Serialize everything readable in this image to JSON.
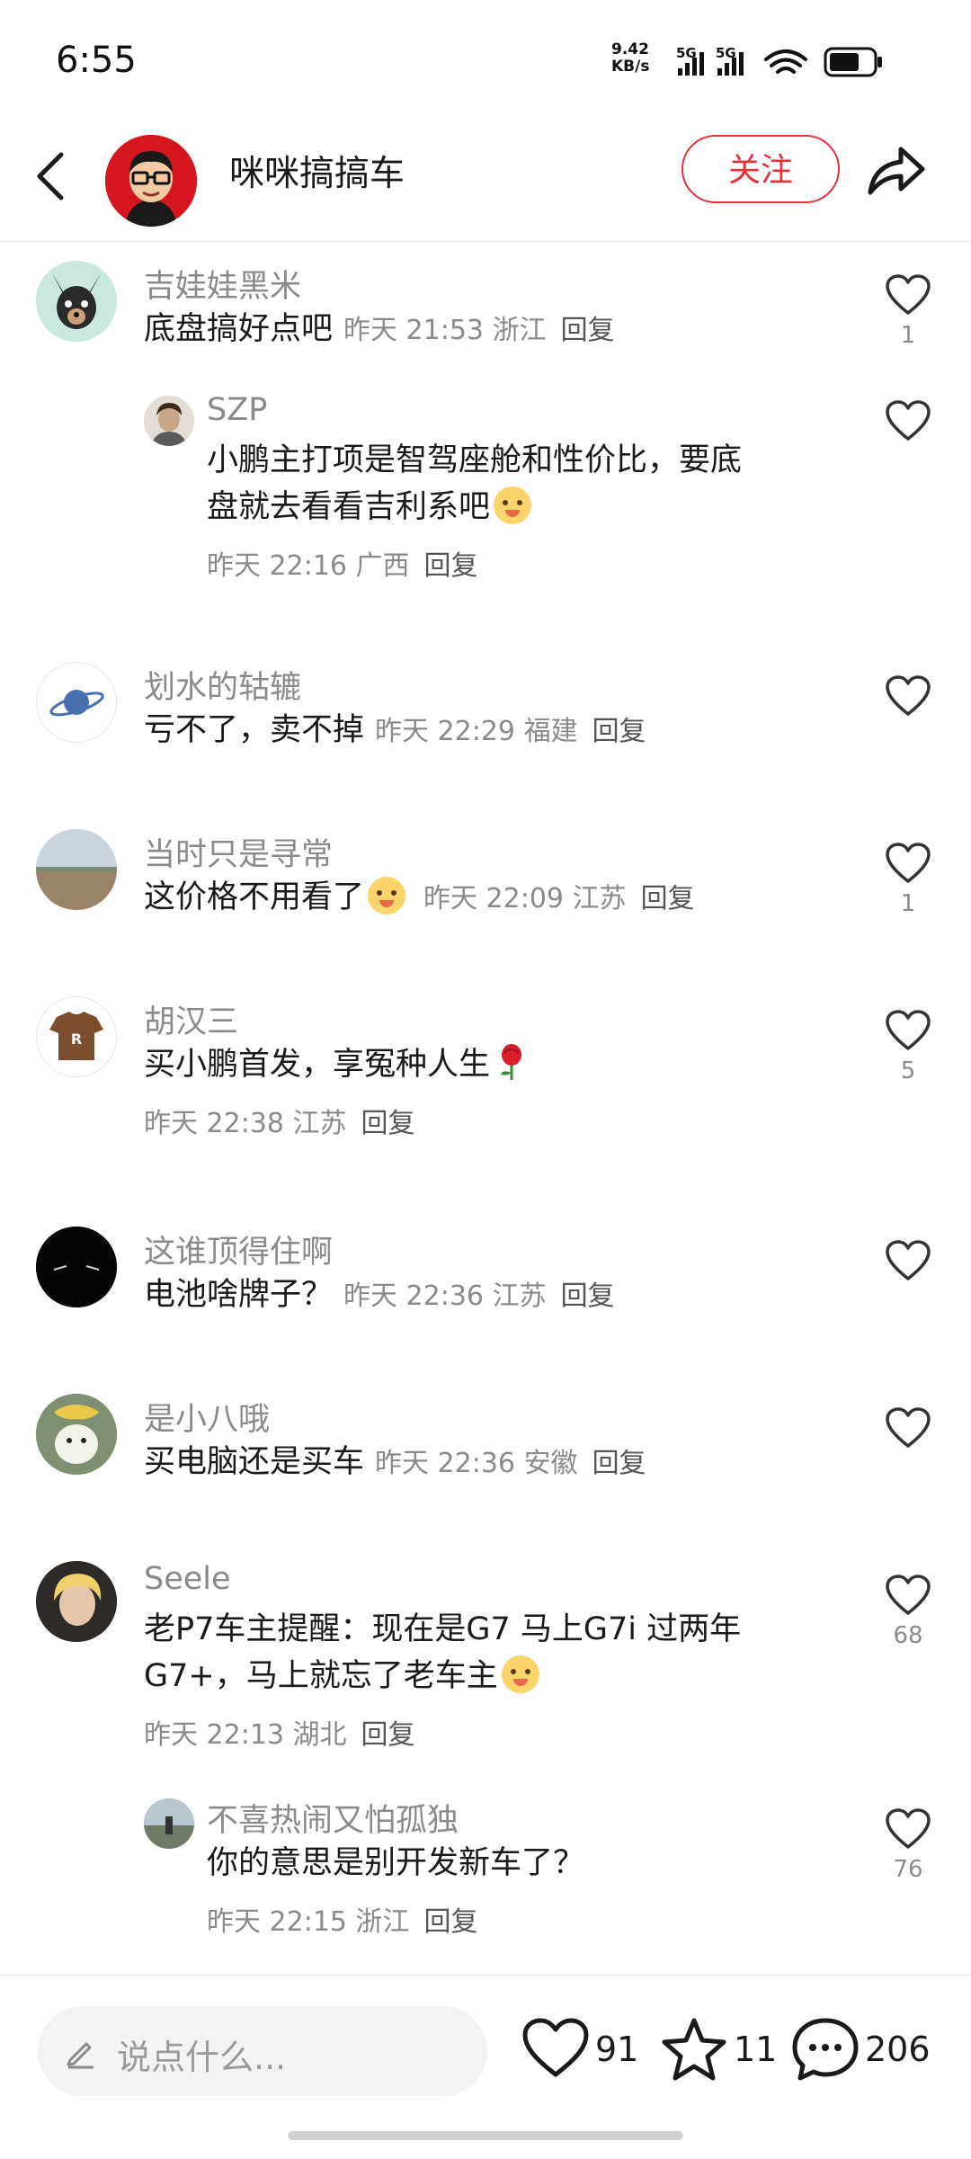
{
  "status_bar": {
    "time": "6:55",
    "net_speed_value": "9.42",
    "net_speed_unit": "KB/s",
    "sim1": "5G",
    "sim2": "5G",
    "battery_level": 0.7
  },
  "header": {
    "author_name": "咪咪搞搞车",
    "follow_label": "关注"
  },
  "comments": [
    {
      "name": "吉娃娃黑米",
      "text": "底盘搞好点吧",
      "time": "昨天 21:53",
      "location": "浙江",
      "reply": "回复",
      "likes": "1"
    },
    {
      "name": "SZP",
      "text_line1": "小鹏主打项是智驾座舱和性价比，要底",
      "text_line2": "盘就去看看吉利系吧",
      "time": "昨天 22:16",
      "location": "广西",
      "reply": "回复",
      "likes": ""
    },
    {
      "name": "划水的轱辘",
      "text": "亏不了，卖不掉",
      "time": "昨天 22:29",
      "location": "福建",
      "reply": "回复",
      "likes": ""
    },
    {
      "name": "当时只是寻常",
      "text": "这价格不用看了",
      "time": "昨天 22:09",
      "location": "江苏",
      "reply": "回复",
      "likes": "1"
    },
    {
      "name": "胡汉三",
      "text": "买小鹏首发，享冤种人生",
      "time": "昨天 22:38",
      "location": "江苏",
      "reply": "回复",
      "likes": "5"
    },
    {
      "name": "这谁顶得住啊",
      "text": "电池啥牌子？",
      "time": "昨天 22:36",
      "location": "江苏",
      "reply": "回复",
      "likes": ""
    },
    {
      "name": "是小八哦",
      "text": "买电脑还是买车",
      "time": "昨天 22:36",
      "location": "安徽",
      "reply": "回复",
      "likes": ""
    },
    {
      "name": "Seele",
      "text_line1": "老P7车主提醒：现在是G7 马上G7i 过两年",
      "text_line2": "G7+，马上就忘了老车主",
      "time": "昨天 22:13",
      "location": "湖北",
      "reply": "回复",
      "likes": "68"
    },
    {
      "name": "不喜热闹又怕孤独",
      "text": "你的意思是别开发新车了？",
      "time": "昨天 22:15",
      "location": "浙江",
      "reply": "回复",
      "likes": "76"
    }
  ],
  "bottom_bar": {
    "input_placeholder": "说点什么...",
    "likes": "91",
    "favorites": "11",
    "comments": "206"
  },
  "colors": {
    "accent": "#e3323c",
    "secondary_text": "#8a8a8a"
  }
}
